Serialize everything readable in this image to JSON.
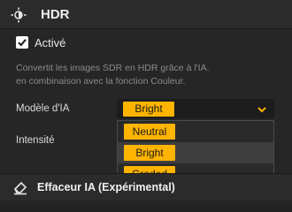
{
  "section": {
    "title": "HDR",
    "icon": "hdr-sun-icon"
  },
  "enable": {
    "label": "Activé",
    "checked": true
  },
  "description": {
    "line1": "Convertit les images SDR en HDR grâce à l'IA.",
    "line2": "en combinaison avec la fonction Couleur."
  },
  "model": {
    "label": "Modèle d'IA",
    "selected": "Bright",
    "options": [
      "Neutral",
      "Bright",
      "Graded"
    ]
  },
  "intensity": {
    "label": "Intensité"
  },
  "next_section": {
    "title": "Effaceur IA (Expérimental)",
    "icon": "eraser-icon"
  },
  "colors": {
    "accent": "#ffb400",
    "background": "#262626",
    "text": "#e6e6e6"
  }
}
